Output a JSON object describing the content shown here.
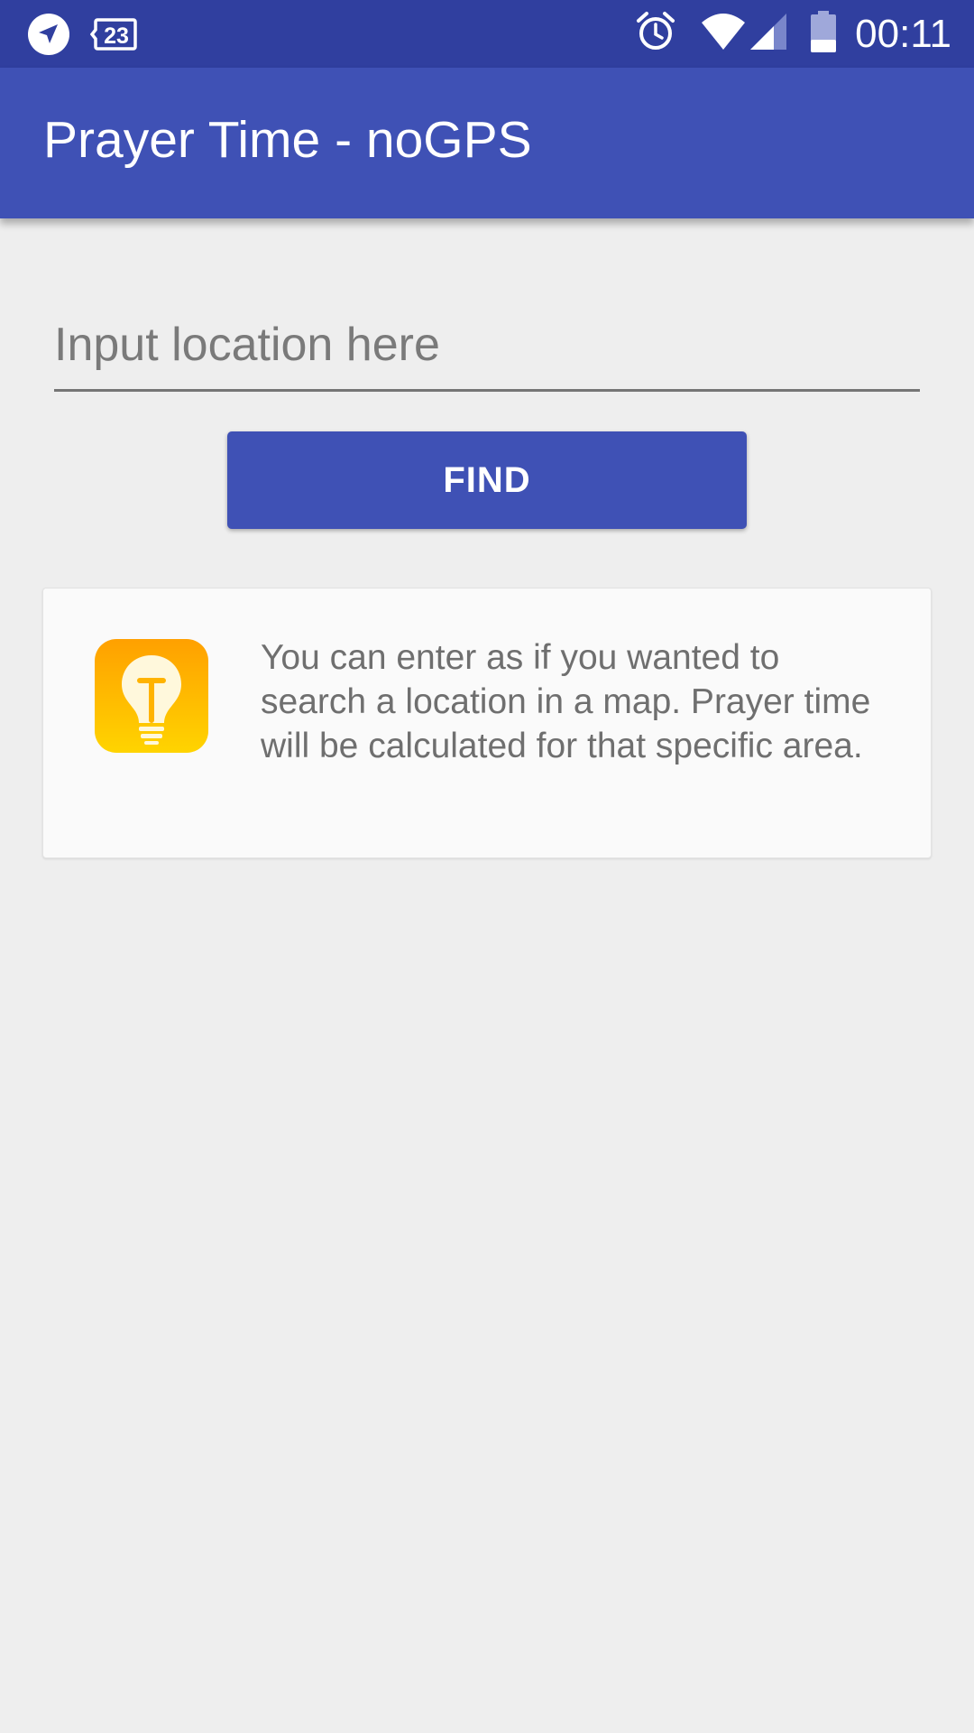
{
  "status_bar": {
    "clock": "00:11",
    "notification_badge": "23",
    "icons": [
      "navigation-arrow-icon",
      "badge-23-icon",
      "alarm-clock-icon",
      "wifi-icon",
      "cellular-signal-icon",
      "battery-icon"
    ]
  },
  "app_bar": {
    "title": "Prayer Time - noGPS"
  },
  "search": {
    "placeholder": "Input location here",
    "value": ""
  },
  "find_button": {
    "label": "FIND"
  },
  "tip_card": {
    "icon": "lightbulb-icon",
    "text": "You can enter as if you wanted to search a location in a map. Prayer time will be calculated for that specific area."
  },
  "colors": {
    "status_bar": "#303f9f",
    "primary": "#3f51b5",
    "background": "#eeeeee",
    "card": "#fafafa",
    "tip_icon_top": "#ffa000",
    "tip_icon_bottom": "#ffd400"
  }
}
